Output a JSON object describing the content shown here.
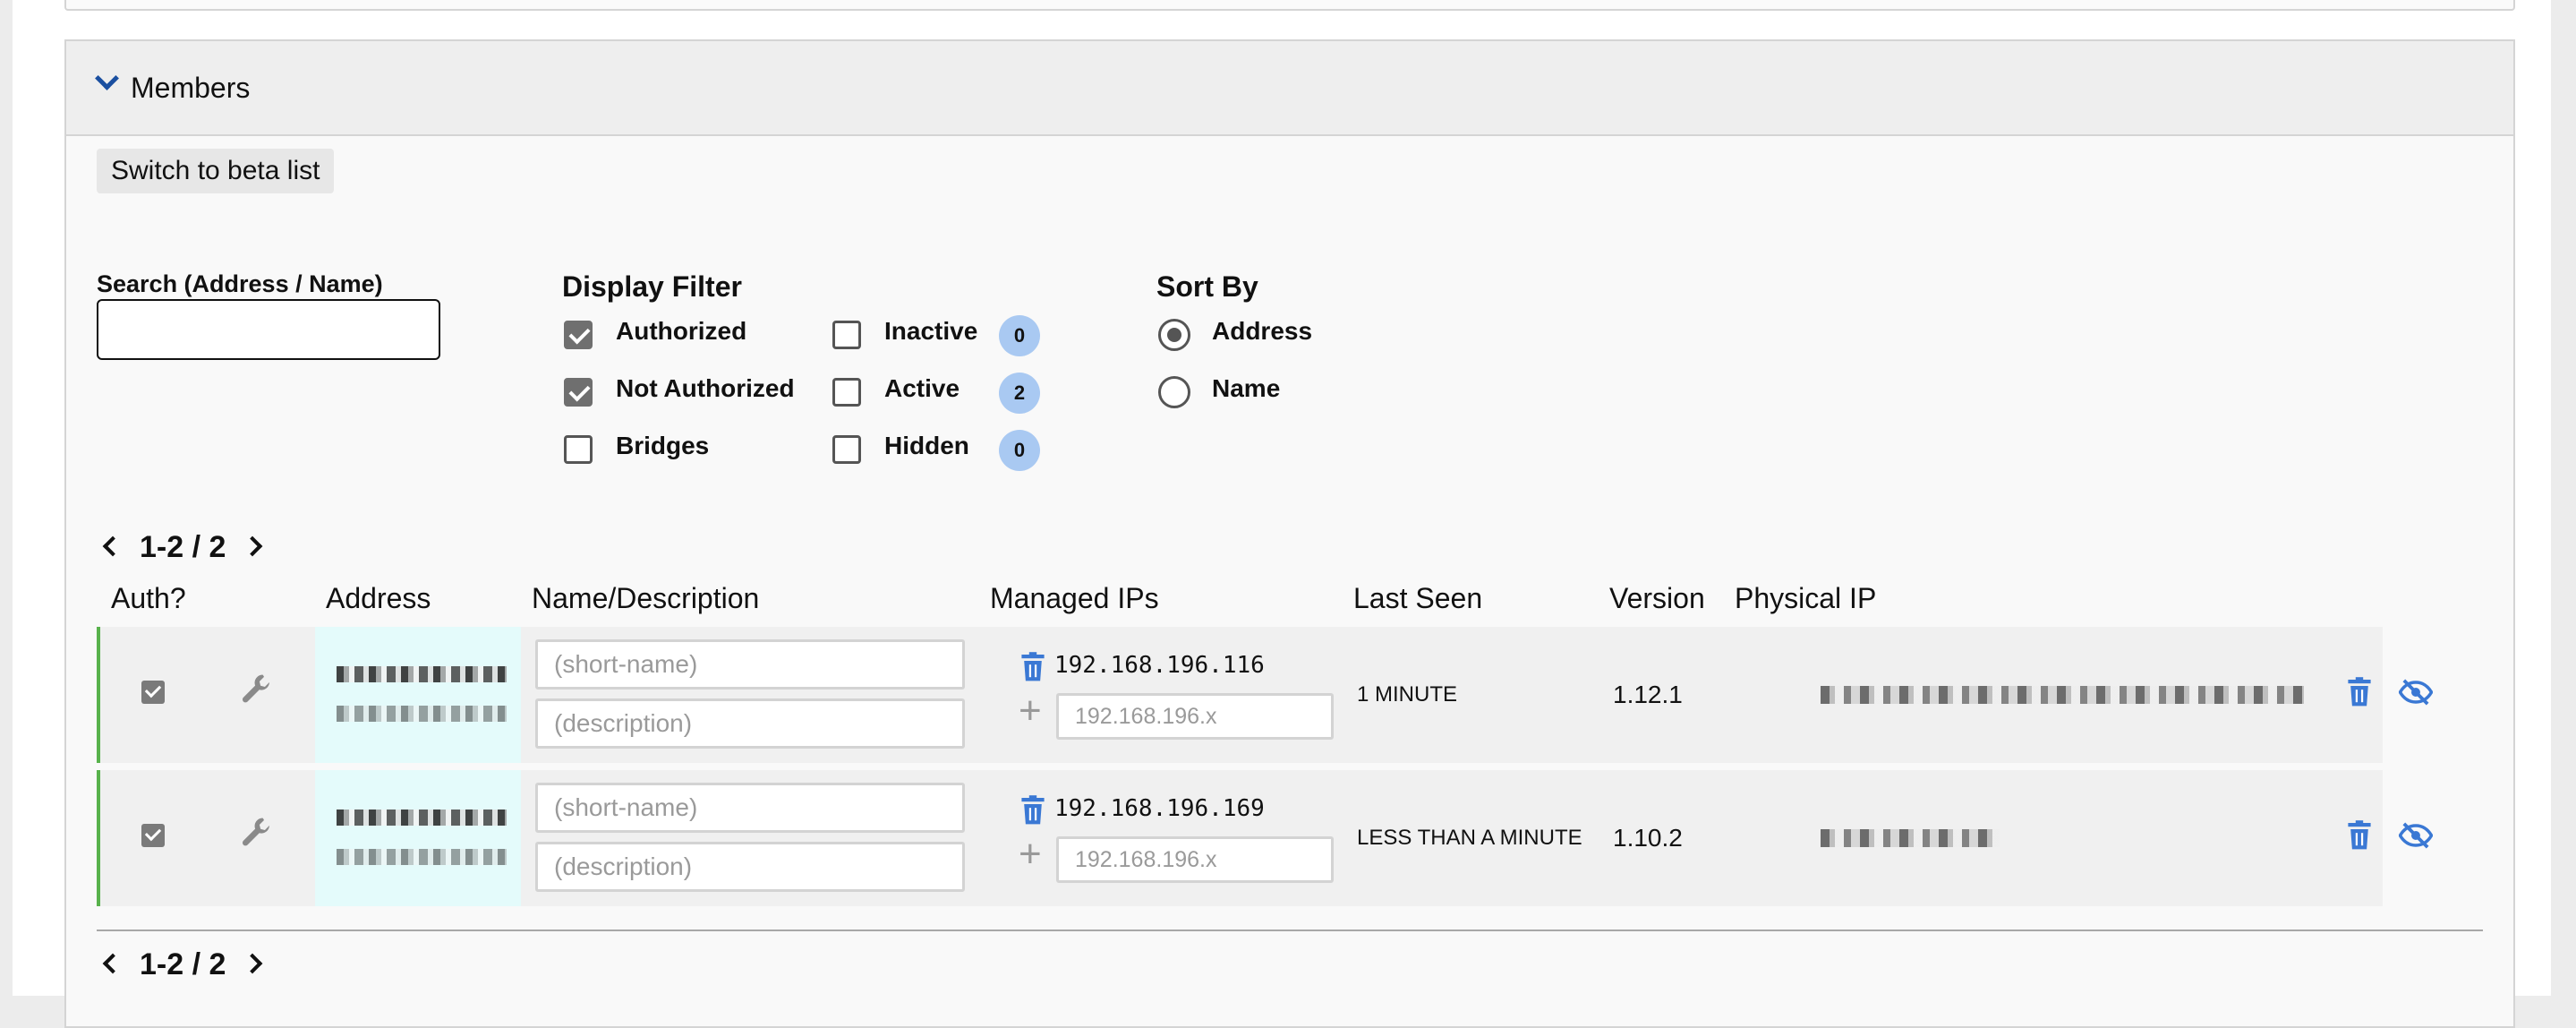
{
  "panel": {
    "title": "Members",
    "beta_button": "Switch to beta list"
  },
  "search": {
    "label": "Search (Address / Name)",
    "value": ""
  },
  "display_filter": {
    "title": "Display Filter",
    "options": [
      {
        "label": "Authorized",
        "checked": true
      },
      {
        "label": "Not Authorized",
        "checked": true
      },
      {
        "label": "Bridges",
        "checked": false
      },
      {
        "label": "Inactive",
        "checked": false,
        "count": "0"
      },
      {
        "label": "Active",
        "checked": false,
        "count": "2"
      },
      {
        "label": "Hidden",
        "checked": false,
        "count": "0"
      }
    ]
  },
  "sort_by": {
    "title": "Sort By",
    "options": [
      {
        "label": "Address",
        "selected": true
      },
      {
        "label": "Name",
        "selected": false
      }
    ]
  },
  "pager": {
    "top": "1-2 / 2",
    "bottom": "1-2 / 2"
  },
  "columns": [
    "Auth?",
    "Address",
    "Name/Description",
    "Managed IPs",
    "Last Seen",
    "Version",
    "Physical IP"
  ],
  "members": [
    {
      "authorized": true,
      "name_placeholder": "(short-name)",
      "description_placeholder": "(description)",
      "managed_ip": "192.168.196.116",
      "new_ip_placeholder": "192.168.196.x",
      "last_seen": "1 MINUTE",
      "version": "1.12.1"
    },
    {
      "authorized": true,
      "name_placeholder": "(short-name)",
      "description_placeholder": "(description)",
      "managed_ip": "192.168.196.169",
      "new_ip_placeholder": "192.168.196.x",
      "last_seen": "LESS THAN A MINUTE",
      "version": "1.10.2"
    }
  ],
  "colors": {
    "accent": "#1a4fa0",
    "icon_blue": "#3a78d4",
    "badge": "#a9c9f2",
    "row_border": "#58b24c",
    "address_bg": "#e4fbfb"
  },
  "icons": {
    "collapse": "chevron-down-icon",
    "settings": "wrench-icon",
    "delete": "trash-icon",
    "add": "plus-icon",
    "hide": "eye-slash-icon",
    "prev": "chevron-left-icon",
    "next": "chevron-right-icon"
  }
}
